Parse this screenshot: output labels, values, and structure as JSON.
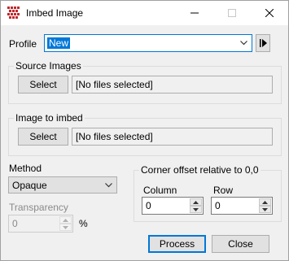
{
  "window": {
    "title": "Imbed Image",
    "icon": "grid-app-icon",
    "controls": [
      "minimize-icon",
      "maximize-icon",
      "close-icon"
    ]
  },
  "profile": {
    "label": "Profile",
    "value": "New",
    "play_icon": "play-bar-icon"
  },
  "source_images": {
    "title": "Source Images",
    "select_label": "Select",
    "files_text": "[No files selected]"
  },
  "image_to_imbed": {
    "title": "Image to imbed",
    "select_label": "Select",
    "files_text": "[No files selected]"
  },
  "method": {
    "label": "Method",
    "value": "Opaque"
  },
  "transparency": {
    "label": "Transparency",
    "value": "0",
    "unit": "%",
    "enabled": false
  },
  "corner_offset": {
    "title": "Corner offset relative to 0,0",
    "column_label": "Column",
    "column_value": "0",
    "row_label": "Row",
    "row_value": "0"
  },
  "buttons": {
    "process": "Process",
    "close": "Close"
  },
  "colors": {
    "accent": "#0078d7",
    "icon_red": "#c0282d"
  }
}
